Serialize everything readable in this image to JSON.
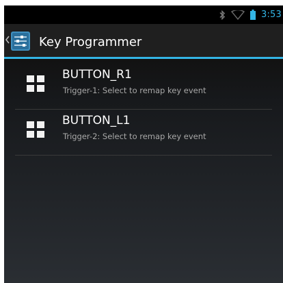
{
  "status_bar": {
    "time": "3:53",
    "icons": [
      "bluetooth-icon",
      "wifi-icon",
      "battery-icon"
    ]
  },
  "action_bar": {
    "title": "Key Programmer",
    "app_icon": "sliders-icon"
  },
  "list": {
    "items": [
      {
        "title": "BUTTON_R1",
        "summary": "Trigger-1: Select to remap key event",
        "icon": "grid-icon"
      },
      {
        "title": "BUTTON_L1",
        "summary": "Trigger-2: Select to remap key event",
        "icon": "grid-icon"
      }
    ]
  },
  "colors": {
    "accent": "#33b5e5",
    "background": "#121212",
    "action_bar": "#1f1f1f",
    "primary_text": "#ffffff",
    "secondary_text": "#a8a8a8"
  }
}
